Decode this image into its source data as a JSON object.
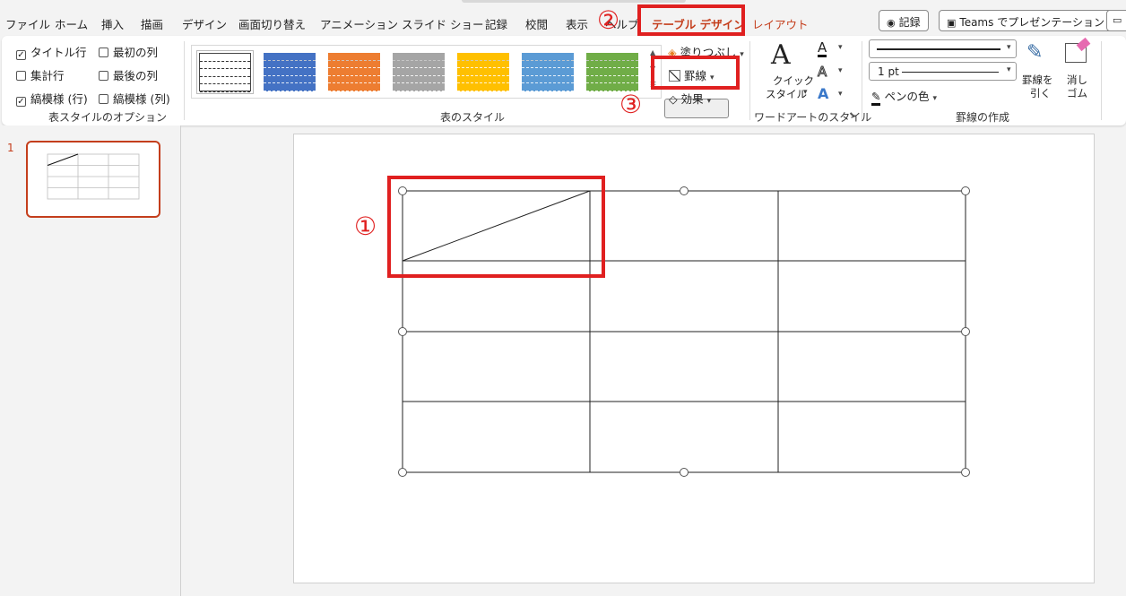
{
  "menu": {
    "tabs": [
      "ファイル",
      "ホーム",
      "挿入",
      "描画",
      "デザイン",
      "画面切り替え",
      "アニメーション",
      "スライド ショー",
      "記録",
      "校閲",
      "表示",
      "ヘルプ",
      "テーブル デザイン",
      "レイアウト"
    ],
    "record_button": "記録",
    "teams_button": "Teams でプレゼンテーション"
  },
  "ribbon": {
    "table_style_options": {
      "items": [
        {
          "label": "タイトル行",
          "checked": true
        },
        {
          "label": "集計行",
          "checked": false
        },
        {
          "label": "縞模様 (行)",
          "checked": true
        },
        {
          "label": "最初の列",
          "checked": false
        },
        {
          "label": "最後の列",
          "checked": false
        },
        {
          "label": "縞模様 (列)",
          "checked": false
        }
      ],
      "group_label": "表スタイルのオプション"
    },
    "table_styles": {
      "group_label": "表のスタイル",
      "swatch_colors": [
        "#ffffff",
        "#4472c4",
        "#ed7d31",
        "#a5a5a5",
        "#ffc000",
        "#5b9bd5",
        "#70ad47"
      ],
      "fill_label": "塗りつぶし",
      "border_label": "罫線",
      "effects_label": "効果"
    },
    "wordart": {
      "quick_style_label1": "クイック",
      "quick_style_label2": "スタイル",
      "group_label": "ワードアートのスタイル"
    },
    "draw_borders": {
      "pen_weight": "1 pt",
      "pen_color_label": "ペンの色",
      "draw_table_label1": "罫線を",
      "draw_table_label2": "引く",
      "eraser_label1": "消し",
      "eraser_label2": "ゴム",
      "group_label": "罫線の作成"
    }
  },
  "annotations": [
    "①",
    "②",
    "③"
  ],
  "thumbnail": {
    "slide_number": "1"
  },
  "colors": {
    "accent": "#c43e1c",
    "highlight": "#e02020"
  }
}
